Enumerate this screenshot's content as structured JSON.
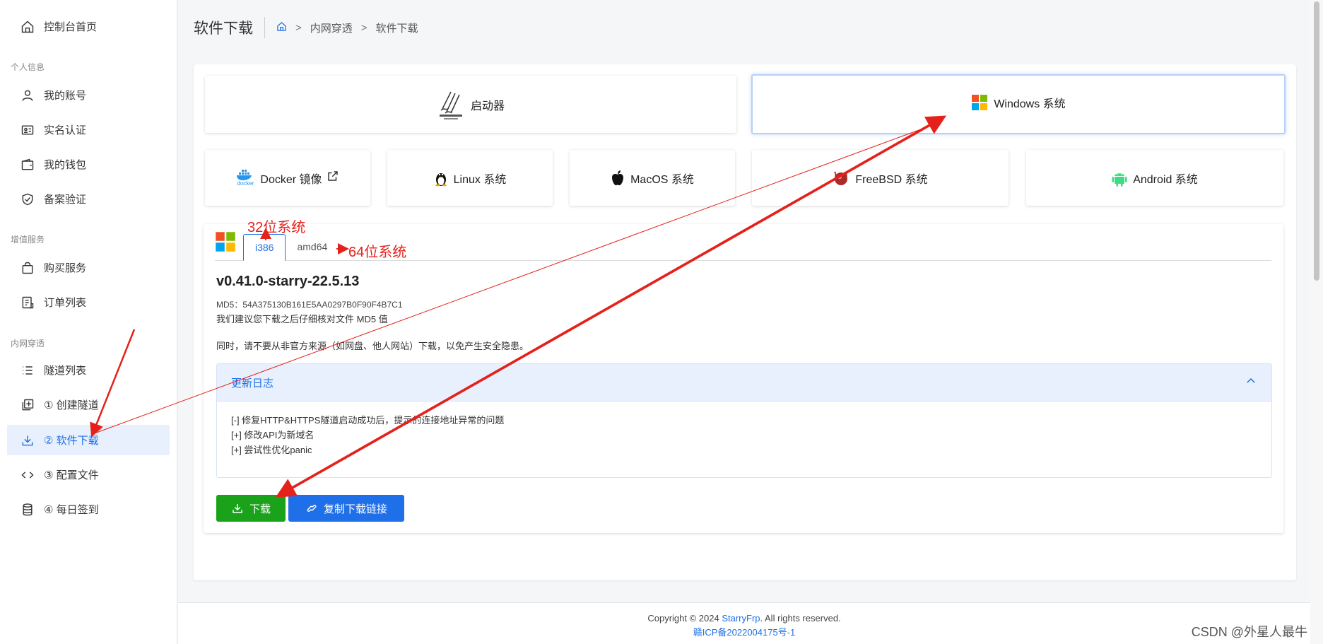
{
  "sidebar": {
    "home": "控制台首页",
    "groups": {
      "personal": "个人信息",
      "value": "增值服务",
      "tunnel": "内网穿透"
    },
    "items": {
      "account": "我的账号",
      "realname": "实名认证",
      "wallet": "我的钱包",
      "filing": "备案验证",
      "buy": "购买服务",
      "orders": "订单列表",
      "tunnels": "隧道列表",
      "create": "① 创建隧道",
      "download": "② 软件下载",
      "config": "③ 配置文件",
      "checkin": "④ 每日签到"
    }
  },
  "header": {
    "title": "软件下载",
    "breadcrumb": [
      "内网穿透",
      "软件下载"
    ]
  },
  "os": {
    "launcher": "启动器",
    "windows": "Windows 系统",
    "docker": "Docker 镜像",
    "linux": "Linux 系统",
    "macos": "MacOS 系统",
    "freebsd": "FreeBSD 系统",
    "android": "Android 系统",
    "docker_logo_text": "docker"
  },
  "detail": {
    "tabs": [
      "i386",
      "amd64"
    ],
    "version": "v0.41.0-starry-22.5.13",
    "md5": "MD5：54A375130B161E5AA0297B0F90F4B7C1",
    "tip1": "我们建议您下载之后仔细核对文件 MD5 值",
    "tip2": "同时，请不要从非官方来源（如网盘、他人网站）下载，以免产生安全隐患。",
    "changelog_title": "更新日志",
    "changelog": [
      "[-] 修复HTTP&HTTPS隧道启动成功后，提示的连接地址异常的问题",
      "[+] 修改API为新域名",
      "[+] 尝试性优化panic"
    ],
    "download_btn": "下载",
    "copy_btn": "复制下载链接"
  },
  "footer": {
    "copyright_pre": "Copyright © 2024 ",
    "brand": "StarryFrp",
    "copyright_post": ". All rights reserved.",
    "icp": "赣ICP备2022004175号-1"
  },
  "annotations": {
    "bit32": "32位系统",
    "bit64": "64位系统"
  },
  "watermark": "CSDN @外星人最牛",
  "colors": {
    "accent": "#1e6fe8",
    "download": "#1aa31a",
    "annotation": "#e5211b"
  }
}
